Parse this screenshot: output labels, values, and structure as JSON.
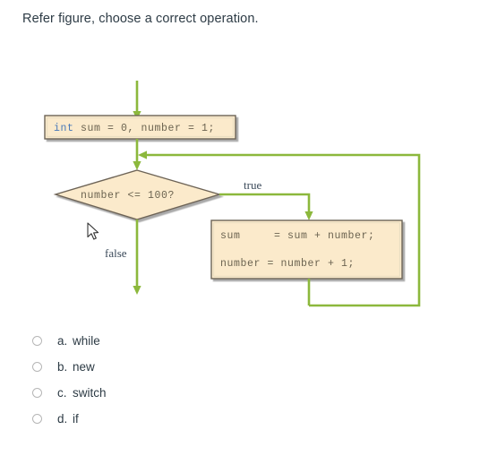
{
  "question": {
    "text": "Refer figure, choose a correct operation."
  },
  "figure": {
    "type": "flowchart",
    "init_box": {
      "keyword": "int",
      "rest": " sum = 0, number = 1;"
    },
    "decision": {
      "text": "number <= 100?"
    },
    "process_box": {
      "line1": "sum     = sum + number;",
      "line2": "number = number + 1;"
    },
    "labels": {
      "true": "true",
      "false": "false"
    },
    "colors": {
      "arrow": "#8cb83c",
      "shape_fill": "#fbeacb",
      "shape_border": "#6d6457",
      "code_text": "#6b6350",
      "keyword_text": "#4a79b8"
    }
  },
  "options": [
    {
      "letter": "a.",
      "label": "while"
    },
    {
      "letter": "b.",
      "label": "new"
    },
    {
      "letter": "c.",
      "label": "switch"
    },
    {
      "letter": "d.",
      "label": "if"
    }
  ]
}
